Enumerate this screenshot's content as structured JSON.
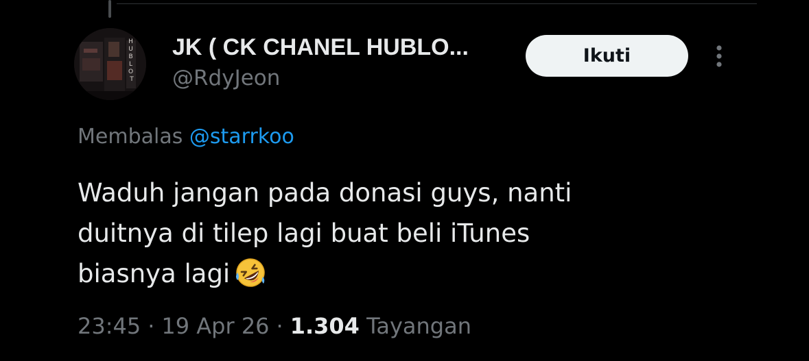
{
  "tweet": {
    "author": {
      "display_name": "JK ( CK CHANEL HUBLO...",
      "handle": "@RdyJeon",
      "avatar_icon": "avatar-image",
      "avatar_text": "HUBLOT"
    },
    "follow_label": "Ikuti",
    "more_icon": "more-vertical-icon",
    "reply": {
      "prefix": "Membalas",
      "mention": "@starrkoo"
    },
    "text_lines": [
      "Waduh jangan pada donasi guys, nanti",
      "duitnya di tilep lagi buat beli iTunes",
      "biasnya lagi"
    ],
    "emoji_icon": "rolling-on-floor-laughing-emoji",
    "meta": {
      "time": "23:45",
      "separator": "·",
      "date": "19 Apr 26",
      "views_count": "1.304",
      "views_label": "Tayangan"
    }
  },
  "colors": {
    "background": "#000000",
    "primary_text": "#e7e9ea",
    "secondary_text": "#71767b",
    "link": "#1d9bf0",
    "button_bg": "#eff3f4",
    "button_text": "#0f1419"
  }
}
